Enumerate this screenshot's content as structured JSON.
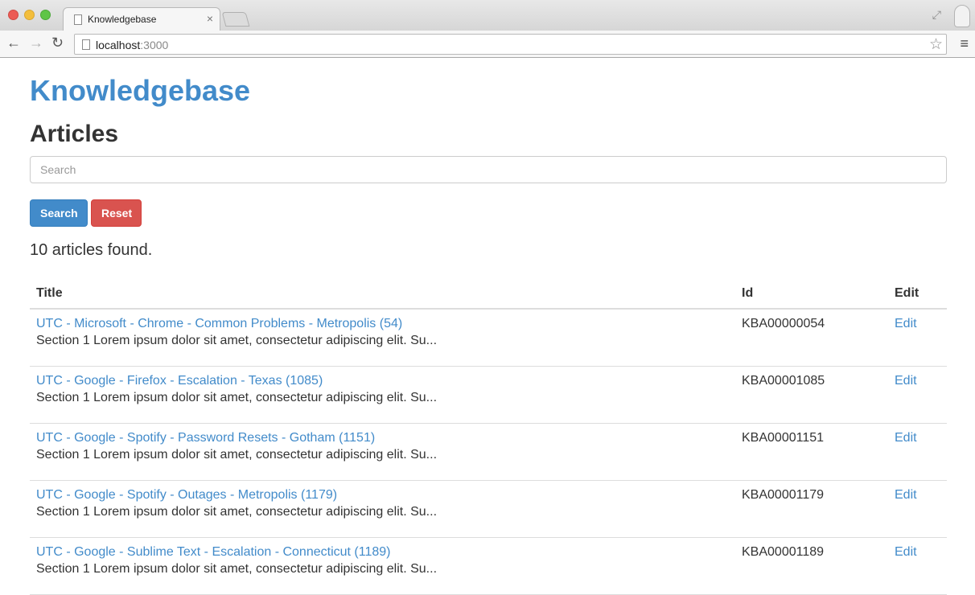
{
  "browser": {
    "tab_title": "Knowledgebase",
    "tab_close": "×",
    "url_host": "localhost",
    "url_port": ":3000"
  },
  "page": {
    "brand": "Knowledgebase",
    "heading": "Articles",
    "search_placeholder": "Search",
    "search_button": "Search",
    "reset_button": "Reset",
    "result_count": "10 articles found."
  },
  "table": {
    "headers": {
      "title": "Title",
      "id": "Id",
      "edit": "Edit"
    },
    "rows": [
      {
        "title": "UTC - Microsoft - Chrome - Common Problems - Metropolis (54)",
        "summary": "Section 1 Lorem ipsum dolor sit amet, consectetur adipiscing elit. Su...",
        "id": "KBA00000054",
        "edit": "Edit"
      },
      {
        "title": "UTC - Google - Firefox - Escalation - Texas (1085)",
        "summary": "Section 1 Lorem ipsum dolor sit amet, consectetur adipiscing elit. Su...",
        "id": "KBA00001085",
        "edit": "Edit"
      },
      {
        "title": "UTC - Google - Spotify - Password Resets - Gotham (1151)",
        "summary": "Section 1 Lorem ipsum dolor sit amet, consectetur adipiscing elit. Su...",
        "id": "KBA00001151",
        "edit": "Edit"
      },
      {
        "title": "UTC - Google - Spotify - Outages - Metropolis (1179)",
        "summary": "Section 1 Lorem ipsum dolor sit amet, consectetur adipiscing elit. Su...",
        "id": "KBA00001179",
        "edit": "Edit"
      },
      {
        "title": "UTC - Google - Sublime Text - Escalation - Connecticut (1189)",
        "summary": "Section 1 Lorem ipsum dolor sit amet, consectetur adipiscing elit. Su...",
        "id": "KBA00001189",
        "edit": "Edit"
      }
    ]
  },
  "colors": {
    "link": "#428bca",
    "primary_button": "#428bca",
    "danger_button": "#d9534f"
  },
  "icons": [
    "close-icon",
    "fullscreen-icon",
    "profile-icon",
    "back-icon",
    "forward-icon",
    "reload-icon",
    "page-icon",
    "star-icon",
    "menu-icon"
  ]
}
